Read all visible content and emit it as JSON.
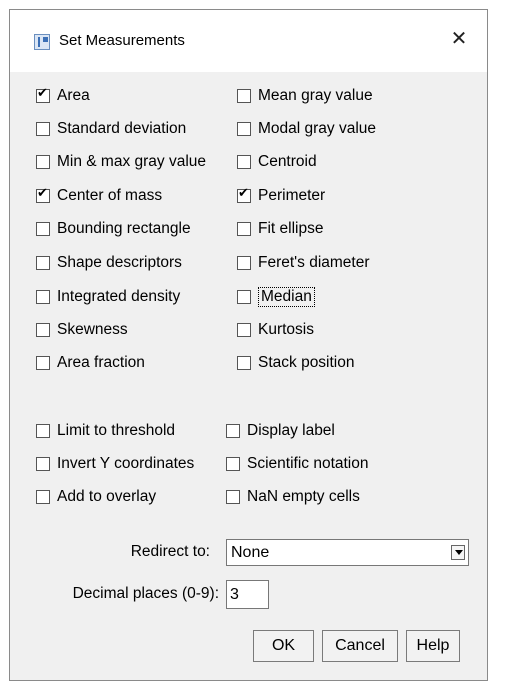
{
  "window": {
    "title": "Set Measurements",
    "close_glyph": "✕",
    "icon": "imagej-icon"
  },
  "measurements": [
    {
      "label": "Area",
      "checked": true
    },
    {
      "label": "Mean gray value",
      "checked": false
    },
    {
      "label": "Standard deviation",
      "checked": false
    },
    {
      "label": "Modal gray value",
      "checked": false
    },
    {
      "label": "Min & max gray value",
      "checked": false
    },
    {
      "label": "Centroid",
      "checked": false
    },
    {
      "label": "Center of mass",
      "checked": true
    },
    {
      "label": "Perimeter",
      "checked": true
    },
    {
      "label": "Bounding rectangle",
      "checked": false
    },
    {
      "label": "Fit ellipse",
      "checked": false
    },
    {
      "label": "Shape descriptors",
      "checked": false
    },
    {
      "label": "Feret's diameter",
      "checked": false
    },
    {
      "label": "Integrated density",
      "checked": false
    },
    {
      "label": "Median",
      "checked": false
    },
    {
      "label": "Skewness",
      "checked": false
    },
    {
      "label": "Kurtosis",
      "checked": false
    },
    {
      "label": "Area fraction",
      "checked": false
    },
    {
      "label": "Stack position",
      "checked": false
    }
  ],
  "options": [
    {
      "label": "Limit to threshold",
      "checked": false
    },
    {
      "label": "Display label",
      "checked": false
    },
    {
      "label": "Invert Y coordinates",
      "checked": false
    },
    {
      "label": "Scientific notation",
      "checked": false
    },
    {
      "label": "Add to overlay",
      "checked": false
    },
    {
      "label": "NaN empty cells",
      "checked": false
    }
  ],
  "redirect": {
    "label": "Redirect to:",
    "value": "None"
  },
  "decimal": {
    "label": "Decimal places (0-9):",
    "value": "3"
  },
  "buttons": {
    "ok": "OK",
    "cancel": "Cancel",
    "help": "Help"
  }
}
